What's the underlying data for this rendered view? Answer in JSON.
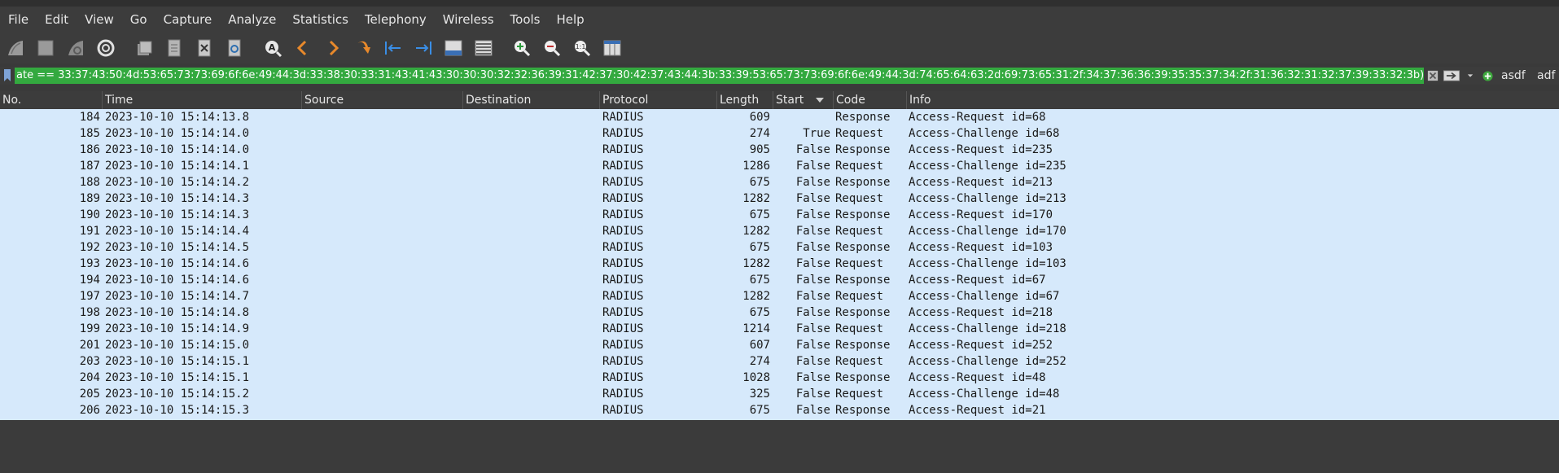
{
  "menu": [
    "File",
    "Edit",
    "View",
    "Go",
    "Capture",
    "Analyze",
    "Statistics",
    "Telephony",
    "Wireless",
    "Tools",
    "Help"
  ],
  "toolbar_icons": [
    "shark-fin-start-icon",
    "stop-square-icon",
    "shark-fin-restart-icon",
    "gear-options-icon",
    "open-folder-icon",
    "file-set-icon",
    "close-file-icon",
    "reload-icon",
    "find-packet-icon",
    "back-arrow-icon",
    "forward-arrow-icon",
    "jump-to-icon",
    "go-first-icon",
    "go-last-icon",
    "autoscroll-icon",
    "colorize-icon",
    "zoom-in-icon",
    "zoom-out-icon",
    "zoom-normal-icon",
    "resize-columns-icon"
  ],
  "filter": {
    "text": "ate == 33:37:43:50:4d:53:65:73:73:69:6f:6e:49:44:3d:33:38:30:33:31:43:41:43:30:30:30:32:32:36:39:31:42:37:30:42:37:43:44:3b:33:39:53:65:73:73:69:6f:6e:49:44:3d:74:65:64:63:2d:69:73:65:31:2f:34:37:36:36:39:35:35:37:34:2f:31:36:32:31:32:37:39:33:32:3b)",
    "button1": "asdf",
    "button2": "adf"
  },
  "columns": [
    "No.",
    "Time",
    "Source",
    "Destination",
    "Protocol",
    "Length",
    "Start",
    "Code",
    "Info"
  ],
  "rows": [
    {
      "no": "184",
      "time": "2023-10-10 15:14:13.8",
      "source": "",
      "destination": "",
      "protocol": "RADIUS",
      "length": "609",
      "start": "",
      "code": "Response",
      "info": "Access-Request id=68"
    },
    {
      "no": "185",
      "time": "2023-10-10 15:14:14.0",
      "source": "",
      "destination": "",
      "protocol": "RADIUS",
      "length": "274",
      "start": "True",
      "code": "Request",
      "info": "Access-Challenge id=68"
    },
    {
      "no": "186",
      "time": "2023-10-10 15:14:14.0",
      "source": "",
      "destination": "",
      "protocol": "RADIUS",
      "length": "905",
      "start": "False",
      "code": "Response",
      "info": "Access-Request id=235"
    },
    {
      "no": "187",
      "time": "2023-10-10 15:14:14.1",
      "source": "",
      "destination": "",
      "protocol": "RADIUS",
      "length": "1286",
      "start": "False",
      "code": "Request",
      "info": "Access-Challenge id=235"
    },
    {
      "no": "188",
      "time": "2023-10-10 15:14:14.2",
      "source": "",
      "destination": "",
      "protocol": "RADIUS",
      "length": "675",
      "start": "False",
      "code": "Response",
      "info": "Access-Request id=213"
    },
    {
      "no": "189",
      "time": "2023-10-10 15:14:14.3",
      "source": "",
      "destination": "",
      "protocol": "RADIUS",
      "length": "1282",
      "start": "False",
      "code": "Request",
      "info": "Access-Challenge id=213"
    },
    {
      "no": "190",
      "time": "2023-10-10 15:14:14.3",
      "source": "",
      "destination": "",
      "protocol": "RADIUS",
      "length": "675",
      "start": "False",
      "code": "Response",
      "info": "Access-Request id=170"
    },
    {
      "no": "191",
      "time": "2023-10-10 15:14:14.4",
      "source": "",
      "destination": "",
      "protocol": "RADIUS",
      "length": "1282",
      "start": "False",
      "code": "Request",
      "info": "Access-Challenge id=170"
    },
    {
      "no": "192",
      "time": "2023-10-10 15:14:14.5",
      "source": "",
      "destination": "",
      "protocol": "RADIUS",
      "length": "675",
      "start": "False",
      "code": "Response",
      "info": "Access-Request id=103"
    },
    {
      "no": "193",
      "time": "2023-10-10 15:14:14.6",
      "source": "",
      "destination": "",
      "protocol": "RADIUS",
      "length": "1282",
      "start": "False",
      "code": "Request",
      "info": "Access-Challenge id=103"
    },
    {
      "no": "194",
      "time": "2023-10-10 15:14:14.6",
      "source": "",
      "destination": "",
      "protocol": "RADIUS",
      "length": "675",
      "start": "False",
      "code": "Response",
      "info": "Access-Request id=67"
    },
    {
      "no": "197",
      "time": "2023-10-10 15:14:14.7",
      "source": "",
      "destination": "",
      "protocol": "RADIUS",
      "length": "1282",
      "start": "False",
      "code": "Request",
      "info": "Access-Challenge id=67"
    },
    {
      "no": "198",
      "time": "2023-10-10 15:14:14.8",
      "source": "",
      "destination": "",
      "protocol": "RADIUS",
      "length": "675",
      "start": "False",
      "code": "Response",
      "info": "Access-Request id=218"
    },
    {
      "no": "199",
      "time": "2023-10-10 15:14:14.9",
      "source": "",
      "destination": "",
      "protocol": "RADIUS",
      "length": "1214",
      "start": "False",
      "code": "Request",
      "info": "Access-Challenge id=218"
    },
    {
      "no": "201",
      "time": "2023-10-10 15:14:15.0",
      "source": "",
      "destination": "",
      "protocol": "RADIUS",
      "length": "607",
      "start": "False",
      "code": "Response",
      "info": "Access-Request id=252"
    },
    {
      "no": "203",
      "time": "2023-10-10 15:14:15.1",
      "source": "",
      "destination": "",
      "protocol": "RADIUS",
      "length": "274",
      "start": "False",
      "code": "Request",
      "info": "Access-Challenge id=252"
    },
    {
      "no": "204",
      "time": "2023-10-10 15:14:15.1",
      "source": "",
      "destination": "",
      "protocol": "RADIUS",
      "length": "1028",
      "start": "False",
      "code": "Response",
      "info": "Access-Request id=48"
    },
    {
      "no": "205",
      "time": "2023-10-10 15:14:15.2",
      "source": "",
      "destination": "",
      "protocol": "RADIUS",
      "length": "325",
      "start": "False",
      "code": "Request",
      "info": "Access-Challenge id=48"
    },
    {
      "no": "206",
      "time": "2023-10-10 15:14:15.3",
      "source": "",
      "destination": "",
      "protocol": "RADIUS",
      "length": "675",
      "start": "False",
      "code": "Response",
      "info": "Access-Request id=21"
    }
  ],
  "colors": {
    "row_bg": "#d6e9fb",
    "filter_bg": "#33a93f",
    "menubar_bg": "#3c3c3c"
  }
}
